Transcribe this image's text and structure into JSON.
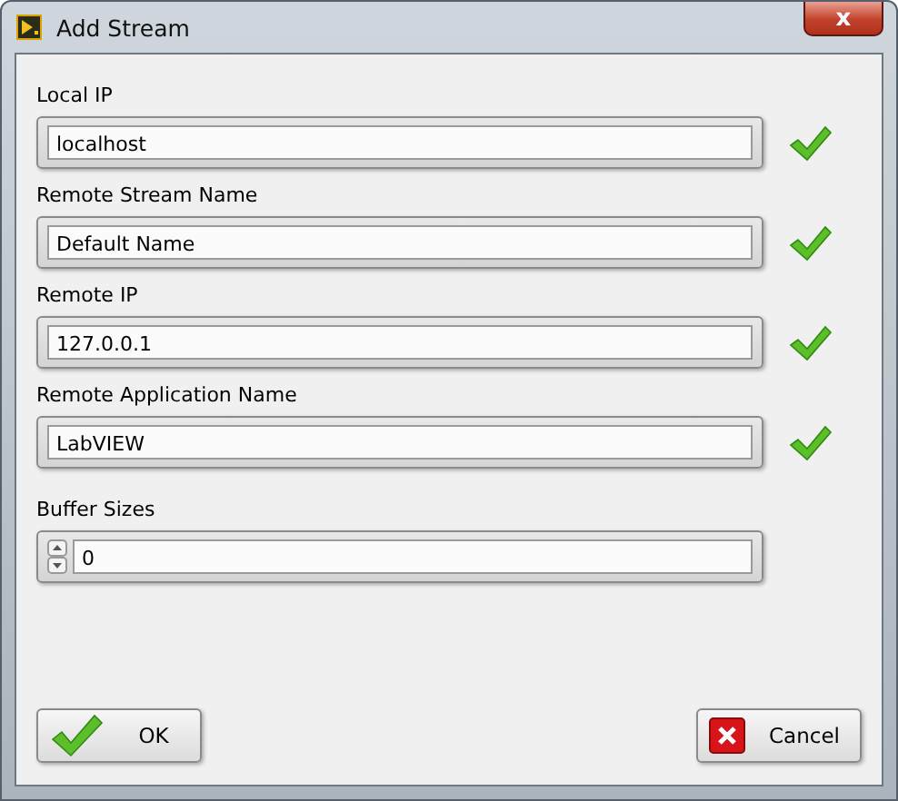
{
  "window": {
    "title": "Add Stream",
    "close_label": "x"
  },
  "fields": [
    {
      "kind": "text",
      "label": "Local IP",
      "value": "localhost",
      "valid": true
    },
    {
      "kind": "text",
      "label": "Remote Stream Name",
      "value": "Default Name",
      "valid": true
    },
    {
      "kind": "text",
      "label": "Remote IP",
      "value": "127.0.0.1",
      "valid": true
    },
    {
      "kind": "text",
      "label": "Remote Application Name",
      "value": "LabVIEW",
      "valid": true
    },
    {
      "kind": "numeric",
      "label": "Buffer Sizes",
      "value": "0"
    }
  ],
  "buttons": [
    {
      "kind": "ok",
      "label": "OK"
    },
    {
      "kind": "cancel",
      "label": "Cancel"
    }
  ]
}
